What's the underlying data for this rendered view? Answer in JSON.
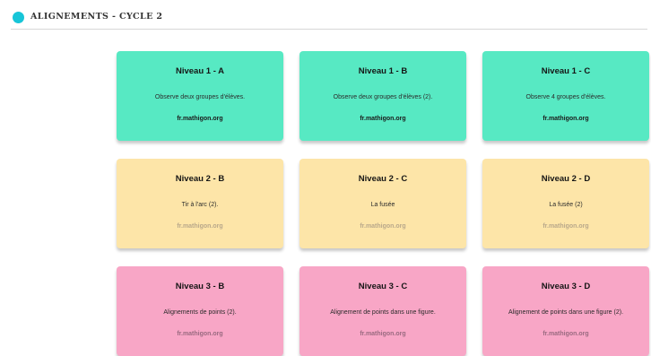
{
  "header": {
    "title": "ALIGNEMENTS - CYCLE 2",
    "dot_color": "#17c5d8"
  },
  "cards": [
    {
      "title": "Niveau 1 - A",
      "desc": "Observe deux groupes d'élèves.",
      "link": "fr.mathigon.org",
      "bg": "#57e9c3",
      "link_color": "#1a1a1a"
    },
    {
      "title": "Niveau 1 - B",
      "desc": "Observe deux groupes d'élèves (2).",
      "link": "fr.mathigon.org",
      "bg": "#57e9c3",
      "link_color": "#1a1a1a"
    },
    {
      "title": "Niveau 1 - C",
      "desc": "Observe 4 groupes d'élèves.",
      "link": "fr.mathigon.org",
      "bg": "#57e9c3",
      "link_color": "#1a1a1a"
    },
    {
      "title": "Niveau 2 - B",
      "desc": "Tir à l'arc (2).",
      "link": "fr.mathigon.org",
      "bg": "#fde5a8",
      "link_color": "#b9a88a"
    },
    {
      "title": "Niveau 2 - C",
      "desc": "La fusée",
      "link": "fr.mathigon.org",
      "bg": "#fde5a8",
      "link_color": "#b9a88a"
    },
    {
      "title": "Niveau 2 - D",
      "desc": "La fusée (2)",
      "link": "fr.mathigon.org",
      "bg": "#fde5a8",
      "link_color": "#b9a88a"
    },
    {
      "title": "Niveau 3 - B",
      "desc": "Alignements de points (2).",
      "link": "fr.mathigon.org",
      "bg": "#f8a6c6",
      "link_color": "#9a6a80"
    },
    {
      "title": "Niveau 3 - C",
      "desc": "Alignement de points dans une figure.",
      "link": "fr.mathigon.org",
      "bg": "#f8a6c6",
      "link_color": "#9a6a80"
    },
    {
      "title": "Niveau 3 - D",
      "desc": "Alignement de points dans une figure (2).",
      "link": "fr.mathigon.org",
      "bg": "#f8a6c6",
      "link_color": "#9a6a80"
    }
  ]
}
